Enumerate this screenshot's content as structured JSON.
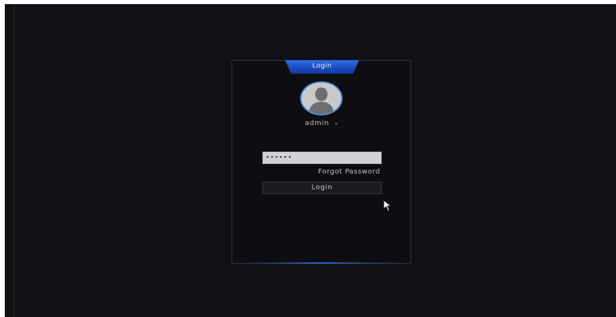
{
  "dialog": {
    "title": "Login"
  },
  "user": {
    "name": "admin",
    "dropdown_icon": "chevron-down-icon"
  },
  "password": {
    "value": "••••••"
  },
  "links": {
    "forgot_password": "Forgot Password"
  },
  "buttons": {
    "login": "Login"
  },
  "colors": {
    "screen_background": "#111014",
    "accent": "#2f6fe8",
    "avatar_ring": "#4a8ad8",
    "input_background": "#d2d2d6"
  },
  "icons": {
    "avatar": "user-avatar-icon",
    "pointer": "mouse-pointer-icon"
  }
}
